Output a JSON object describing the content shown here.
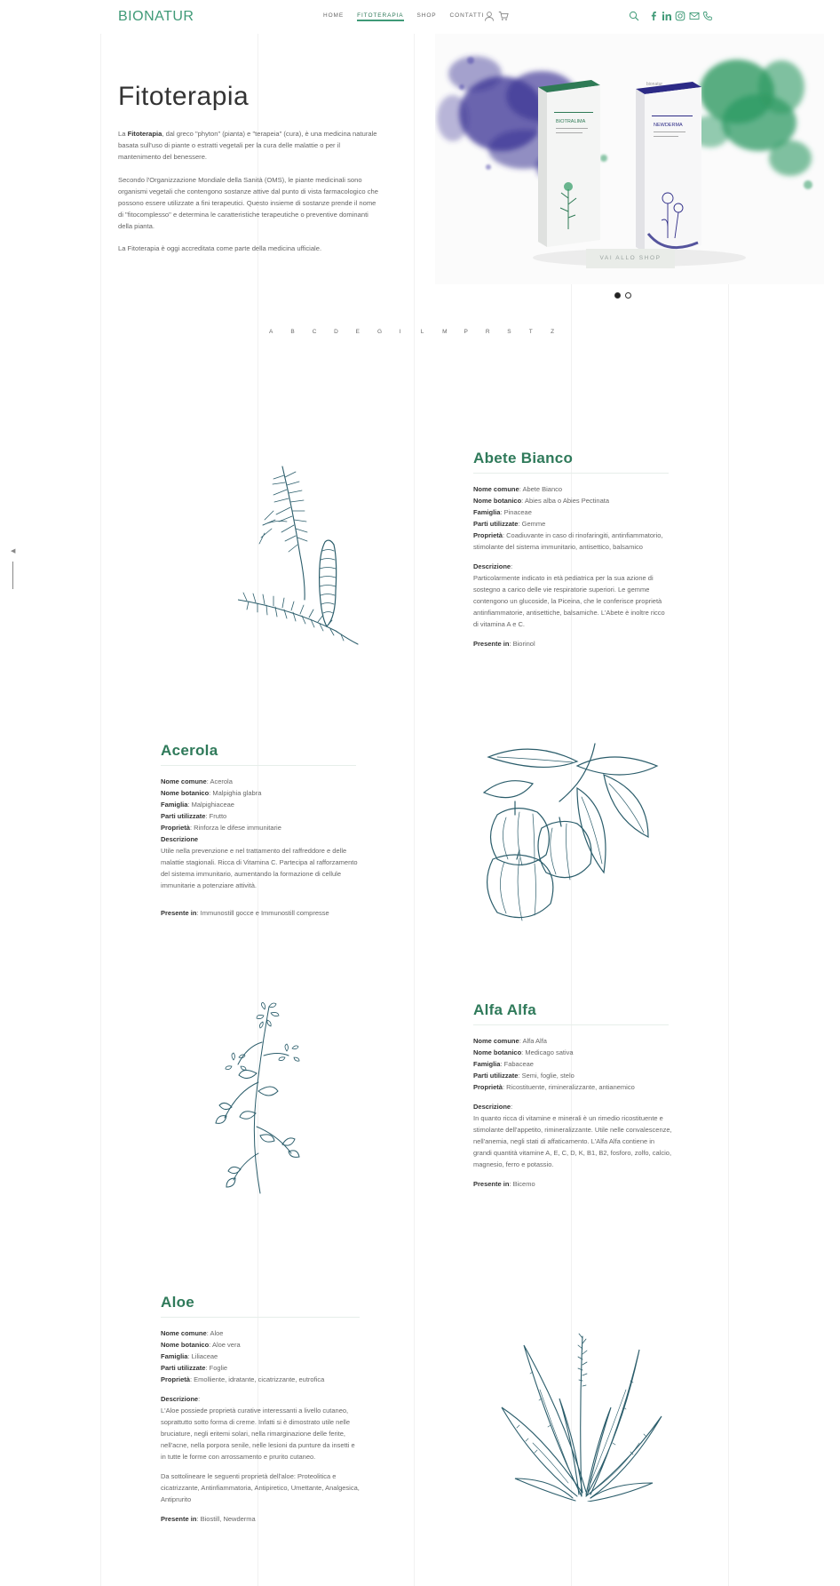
{
  "header": {
    "logo": "BIONATUR",
    "nav": [
      "HOME",
      "FITOTERAPIA",
      "SHOP",
      "CONTATTI"
    ],
    "active_nav": "FITOTERAPIA",
    "icons": [
      "user-icon",
      "cart-icon",
      "search-icon",
      "facebook-icon",
      "linkedin-icon",
      "instagram-icon",
      "mail-icon",
      "phone-icon"
    ]
  },
  "hero": {
    "title": "Fitoterapia",
    "p1_pre": "La ",
    "p1_bold": "Fitoterapia",
    "p1_post": ", dal greco \"phyton\" (pianta) e \"terapeia\" (cura), è una medicina naturale basata sull'uso di piante o estratti vegetali per la cura delle malattie o per il mantenimento del benessere.",
    "p2": "Secondo l'Organizzazione Mondiale della Sanità (OMS), le piante medicinali sono organismi vegetali che contengono sostanze attive dal punto di vista farmacologico che possono essere utilizzate a fini terapeutici. Questo insieme di sostanze prende il nome di \"fitocomplesso\" e determina le caratteristiche terapeutiche o preventive dominanti della pianta.",
    "p3": "La Fitoterapia è oggi accreditata come parte della medicina ufficiale.",
    "banner": {
      "product_left": "BIOTRALIMA",
      "product_right": "NEWDERMA",
      "brand_small": "bionatur",
      "cta": "VAI ALLO SHOP"
    },
    "slides": 2,
    "active_slide": 1
  },
  "alphabet": [
    "A",
    "B",
    "C",
    "D",
    "E",
    "G",
    "I",
    "L",
    "M",
    "P",
    "R",
    "S",
    "T",
    "Z"
  ],
  "labels": {
    "common": "Nome comune",
    "botanic": "Nome botanico",
    "family": "Famiglia",
    "parts": "Parti utilizzate",
    "properties": "Proprietà",
    "description": "Descrizione",
    "present": "Presente in"
  },
  "plants": [
    {
      "name": "Abete Bianco",
      "common": "Abete Bianco",
      "botanic": "Abies alba o Abies Pectinata",
      "family": "Pinaceae",
      "parts": "Gemme",
      "properties": "Coadiuvante in caso di rinofaringiti, antinfiammatorio, stimolante del sistema immunitario, antisettico, balsamico",
      "description": "Particolarmente indicato in età pediatrica per la sua azione di sostegno a carico delle vie respiratorie superiori. Le gemme contengono un glucoside, la Piceina, che le conferisce proprietà antinfiammatorie, antisettiche, balsamiche. L'Abete è inoltre ricco di vitamina A e C.",
      "present": "Biorinol",
      "illustration": "fir-branch-illustration"
    },
    {
      "name": "Acerola",
      "common": "Acerola",
      "botanic": "Malpighia glabra",
      "family": "Malpighiaceae",
      "parts": "Frutto",
      "properties": "Rinforza le difese immunitarie",
      "description": "Utile nella prevenzione e nel trattamento del raffreddore e delle malattie stagionali. Ricca di Vitamina C. Partecipa al rafforzamento del sistema immunitario, aumentando la formazione di cellule immunitarie a potenziare attività.",
      "present": "Immunostill gocce e Immunostill compresse",
      "illustration": "acerola-illustration"
    },
    {
      "name": "Alfa Alfa",
      "common": "Alfa Alfa",
      "botanic": "Medicago sativa",
      "family": "Fabaceae",
      "parts": "Semi, foglie, stelo",
      "properties": "Ricostituente, rimineralizzante, antianemico",
      "description": "In quanto ricca di vitamine e minerali è un rimedio ricostituente e stimolante dell'appetito, rimineralizzante. Utile nelle convalescenze, nell'anemia, negli stati di affaticamento. L'Alfa Alfa contiene in grandi quantità vitamine A, E, C, D, K, B1, B2, fosforo, zolfo, calcio, magnesio, ferro e potassio.",
      "present": "Bicemo",
      "illustration": "alfalfa-illustration"
    },
    {
      "name": "Aloe",
      "common": "Aloe",
      "botanic": "Aloe vera",
      "family": "Liliaceae",
      "parts": "Foglie",
      "properties": "Emolliente, idratante, cicatrizzante, eutrofica",
      "description": "L'Aloe possiede proprietà curative interessanti a livello cutaneo, soprattutto sotto forma di creme. Infatti si è dimostrato utile nelle bruciature, negli eritemi solari, nella rimarginazione delle ferite, nell'acne, nella porpora senile, nelle lesioni da punture da insetti e in tutte le forme con arrossamento e prurito cutaneo.",
      "description2": "Da sottolineare le seguenti proprietà dell'aloe: Proteolitica e cicatrizzante, Antinfiammatoria, Antipiretico, Umettante, Analgesica, Antiprurito",
      "present": "Biostill, Newderma",
      "illustration": "aloe-illustration"
    }
  ],
  "colors": {
    "brand": "#3f9a77",
    "title": "#2f7a5a",
    "illustration": "#2b5d6b",
    "watercolor_blue": "#3a3394",
    "watercolor_green": "#2e9a63"
  }
}
